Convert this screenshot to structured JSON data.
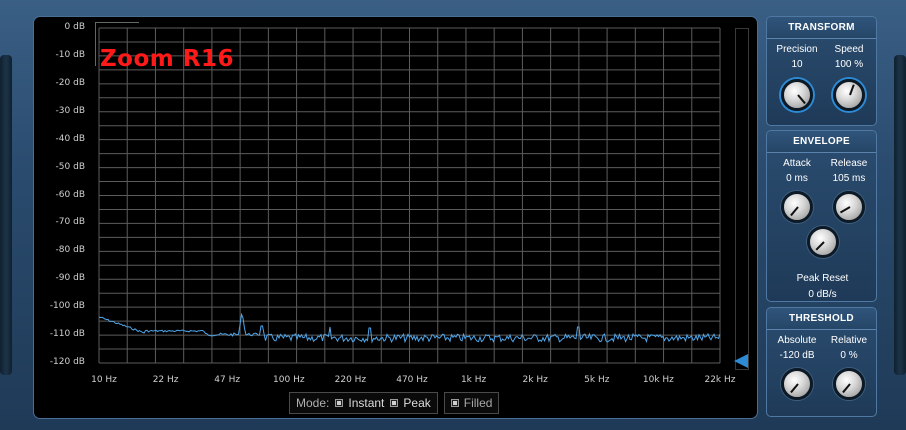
{
  "display": {
    "title": "Zoom R16",
    "y_axis": [
      "0 dB",
      "-10 dB",
      "-20 dB",
      "-30 dB",
      "-40 dB",
      "-50 dB",
      "-60 dB",
      "-70 dB",
      "-80 dB",
      "-90 dB",
      "-100 dB",
      "-110 dB",
      "-120 dB"
    ],
    "x_axis": [
      "10 Hz",
      "22 Hz",
      "47 Hz",
      "100 Hz",
      "220 Hz",
      "470 Hz",
      "1k Hz",
      "2k Hz",
      "5k Hz",
      "10k Hz",
      "22k Hz"
    ],
    "trace_color": "#4fa6ea",
    "title_color": "#ff1a1a"
  },
  "mode": {
    "caption": "Mode:",
    "instant": "Instant",
    "peak": "Peak",
    "filled": "Filled"
  },
  "transform": {
    "title": "TRANSFORM",
    "precision": {
      "label": "Precision",
      "value": "10"
    },
    "speed": {
      "label": "Speed",
      "value": "100 %"
    }
  },
  "envelope": {
    "title": "ENVELOPE",
    "attack": {
      "label": "Attack",
      "value": "0 ms"
    },
    "release": {
      "label": "Release",
      "value": "105 ms"
    },
    "peak_reset": {
      "label": "Peak Reset",
      "value": "0 dB/s"
    }
  },
  "threshold": {
    "title": "THRESHOLD",
    "absolute": {
      "label": "Absolute",
      "value": "-120 dB"
    },
    "relative": {
      "label": "Relative",
      "value": "0 %"
    }
  }
}
